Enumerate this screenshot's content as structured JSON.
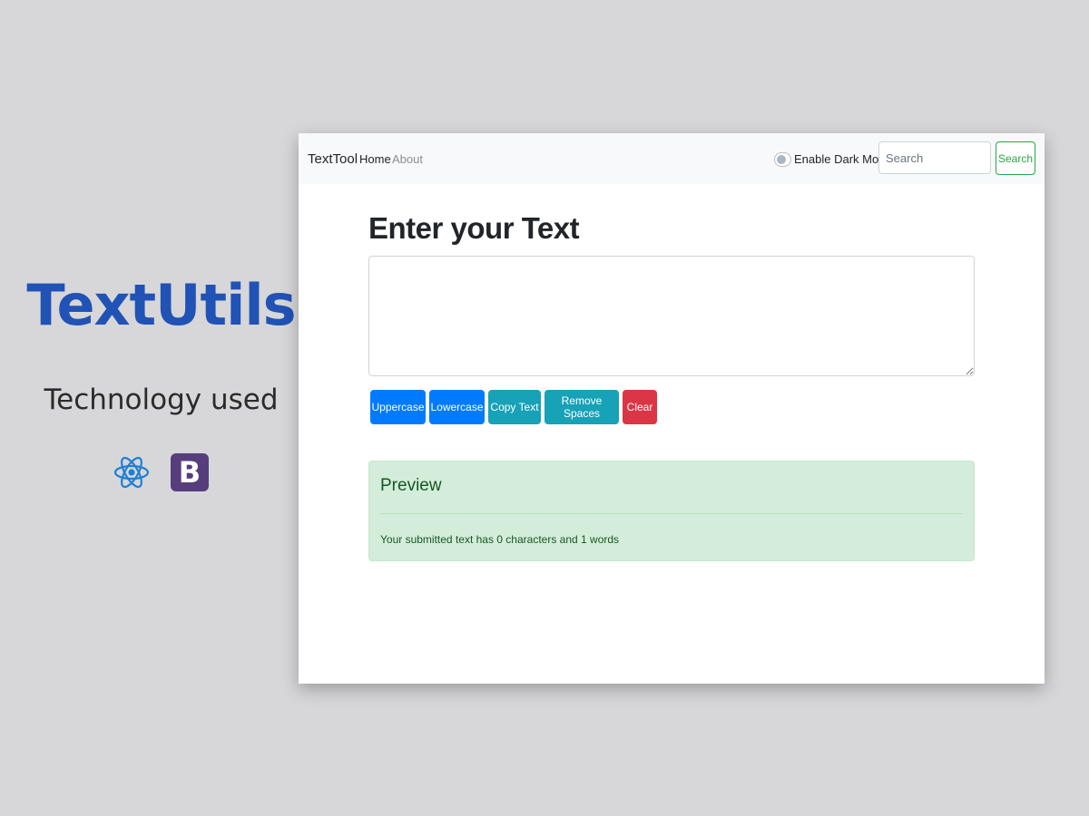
{
  "promo": {
    "title": "TextUtils",
    "subtitle": "Technology used",
    "tech_icons": [
      "react-icon",
      "bootstrap-icon"
    ],
    "bootstrap_letter": "B"
  },
  "navbar": {
    "brand": "TextTool",
    "links": [
      {
        "label": "Home",
        "active": true
      },
      {
        "label": "About",
        "active": false
      }
    ],
    "dark_mode_label": "Enable Dark Mode",
    "dark_mode_enabled": false,
    "search_placeholder": "Search",
    "search_value": "",
    "search_button": "Search"
  },
  "form": {
    "heading": "Enter your Text",
    "textarea_value": "",
    "buttons": [
      {
        "label": "Uppercase",
        "style": "primary"
      },
      {
        "label": "Lowercase",
        "style": "primary"
      },
      {
        "label": "Copy Text",
        "style": "info"
      },
      {
        "label": "Remove Spaces",
        "style": "info"
      },
      {
        "label": "Clear",
        "style": "danger"
      }
    ]
  },
  "preview": {
    "title": "Preview",
    "summary": "Your submitted text has 0 characters and 1 words"
  },
  "colors": {
    "background": "#d7d7d9",
    "promo_title": "#2152b5",
    "primary": "#007bff",
    "info": "#17a2b8",
    "danger": "#dc3545",
    "success": "#28a745",
    "preview_bg": "#d4edda",
    "preview_text": "#155724"
  }
}
